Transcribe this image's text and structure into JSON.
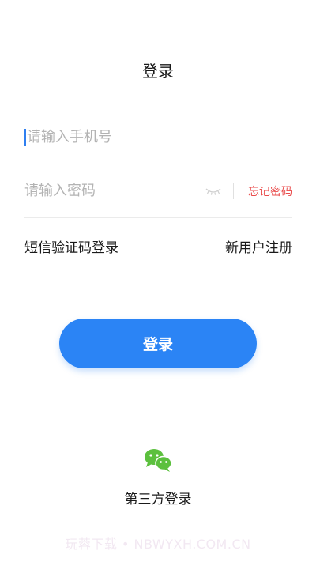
{
  "header": {
    "title": "登录"
  },
  "phone_field": {
    "placeholder": "请输入手机号",
    "value": ""
  },
  "password_field": {
    "placeholder": "请输入密码",
    "value": ""
  },
  "forgot_password": "忘记密码",
  "links": {
    "sms_login": "短信验证码登录",
    "register": "新用户注册"
  },
  "login_button": {
    "label": "登录",
    "color": "#2b84f5"
  },
  "third_party": {
    "label": "第三方登录",
    "icon": "wechat-icon",
    "color": "#5cc03e"
  },
  "watermark": "玩蓉下载 • NBWYXH.COM.CN"
}
